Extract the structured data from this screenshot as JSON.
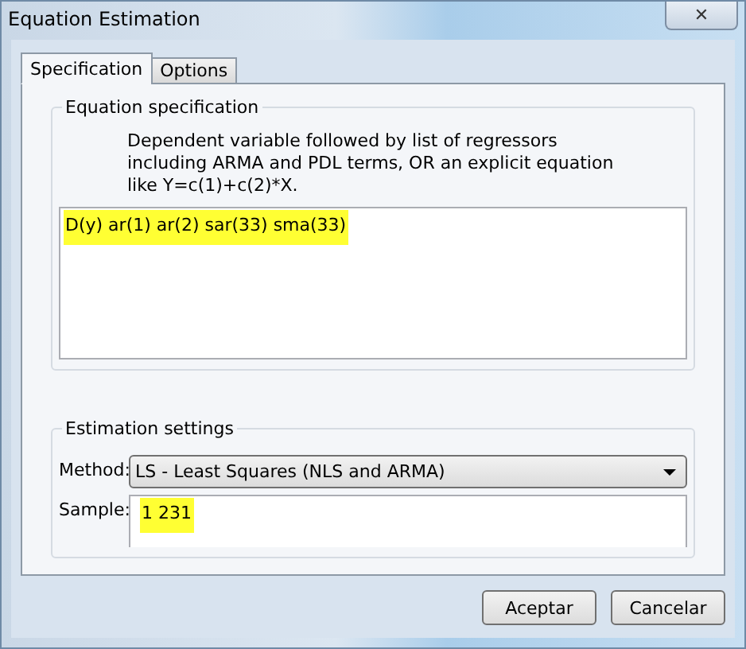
{
  "window": {
    "title": "Equation Estimation",
    "close_label": "✕"
  },
  "tabs": [
    {
      "label": "Specification",
      "selected": true
    },
    {
      "label": "Options",
      "selected": false
    }
  ],
  "equation_group": {
    "title": "Equation specification",
    "hint": "Dependent variable followed by list of regressors including ARMA and PDL terms, OR an explicit equation like Y=c(1)+c(2)*X.",
    "value": "D(y) ar(1) ar(2) sar(33) sma(33)",
    "highlighted": true
  },
  "estimation_group": {
    "title": "Estimation settings",
    "method_label": "Method:",
    "method_value": "LS  -  Least Squares (NLS and ARMA)",
    "sample_label": "Sample:",
    "sample_value": "1 231",
    "sample_highlighted": true
  },
  "buttons": [
    {
      "label": "Aceptar"
    },
    {
      "label": "Cancelar"
    }
  ]
}
